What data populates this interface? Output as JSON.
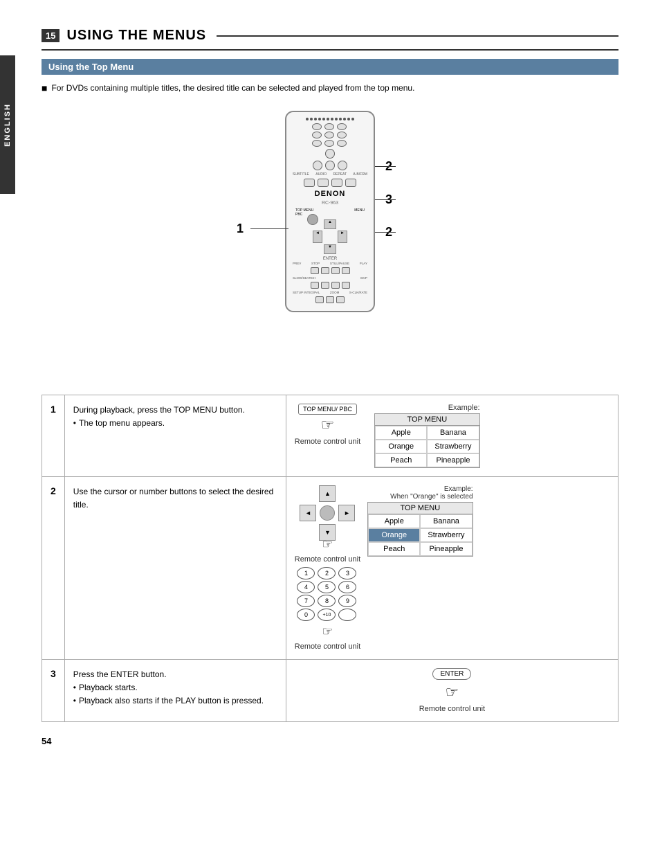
{
  "page": {
    "number": "15",
    "title": "USING THE MENUS",
    "footer_page": "54",
    "side_label": "ENGLISH"
  },
  "section": {
    "heading": "Using the Top Menu"
  },
  "intro": {
    "bullet": "■",
    "text": "For DVDs containing multiple titles, the desired title can be selected and played from the top menu."
  },
  "diagram": {
    "brand": "DENON",
    "model": "RC-963",
    "labels": {
      "top_menu": "TOP MENU PBC",
      "menu": "MENU"
    },
    "callouts": [
      "1",
      "2",
      "3",
      "2"
    ]
  },
  "steps": [
    {
      "number": "1",
      "text_main": "During playback, press the TOP MENU button.",
      "bullets": [
        "The top menu appears."
      ],
      "example_label": "Example:",
      "remote_label": "Remote control unit",
      "top_menu_btn_label": "TOP MENU/ PBC",
      "menu_title": "TOP MENU",
      "menu_items": [
        {
          "label": "Apple",
          "selected": false
        },
        {
          "label": "Banana",
          "selected": false
        },
        {
          "label": "Orange",
          "selected": false
        },
        {
          "label": "Strawberry",
          "selected": false
        },
        {
          "label": "Peach",
          "selected": false
        },
        {
          "label": "Pineapple",
          "selected": false
        }
      ]
    },
    {
      "number": "2",
      "text_main": "Use the cursor or number buttons to select the desired title.",
      "bullets": [],
      "example_label": "Example:\nWhen \"Orange\" is selected",
      "remote_label": "Remote control unit",
      "menu_title": "TOP MENU",
      "menu_items": [
        {
          "label": "Apple",
          "selected": false
        },
        {
          "label": "Banana",
          "selected": false
        },
        {
          "label": "Orange",
          "selected": true
        },
        {
          "label": "Strawberry",
          "selected": false
        },
        {
          "label": "Peach",
          "selected": false
        },
        {
          "label": "Pineapple",
          "selected": false
        }
      ],
      "numpad": [
        "1",
        "2",
        "3",
        "4",
        "5",
        "6",
        "7",
        "8",
        "9",
        "0",
        "+10",
        ""
      ]
    },
    {
      "number": "3",
      "text_main": "Press the ENTER button.",
      "bullets": [
        "Playback starts.",
        "Playback also starts if the PLAY button is pressed."
      ],
      "remote_label": "Remote control unit",
      "enter_label": "ENTER"
    }
  ]
}
